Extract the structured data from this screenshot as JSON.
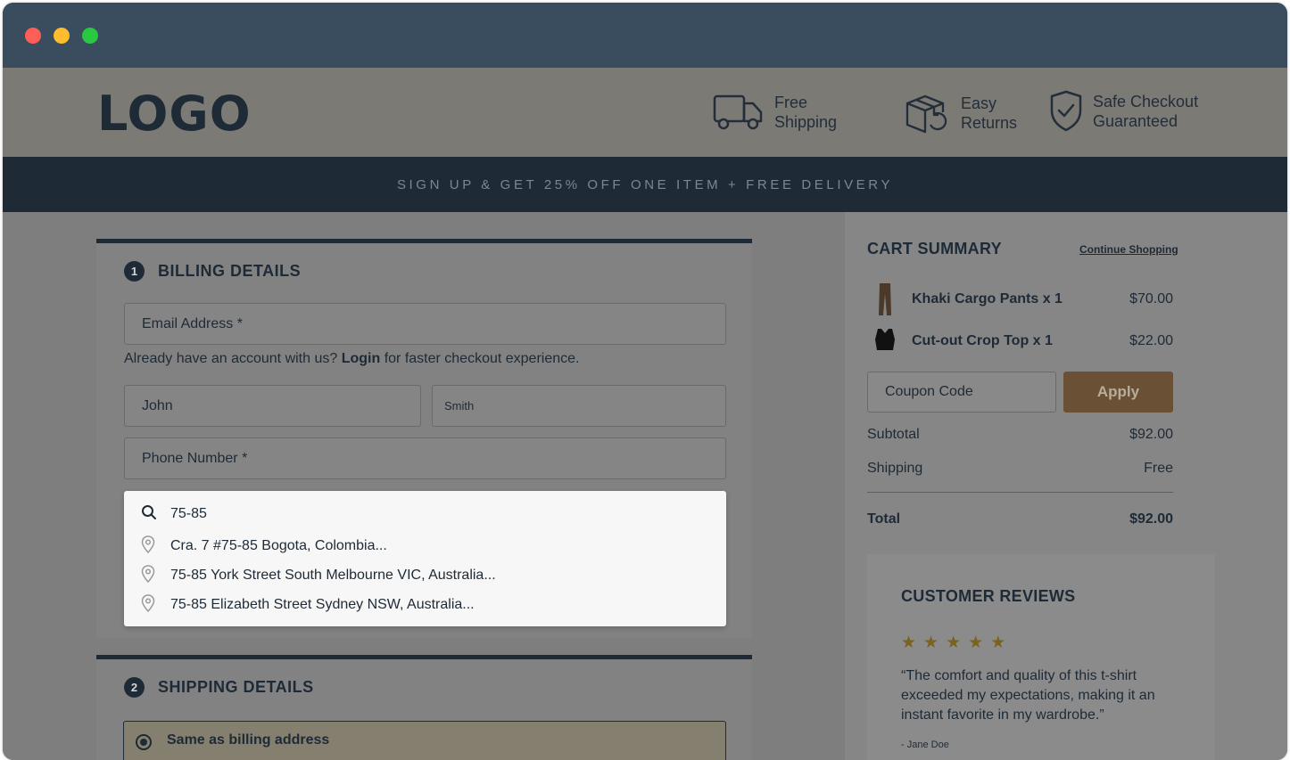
{
  "window": {
    "controls": [
      "close",
      "minimize",
      "maximize"
    ]
  },
  "header": {
    "logo": "LOGO",
    "features": [
      {
        "icon": "truck-icon",
        "line1": "Free",
        "line2": "Shipping"
      },
      {
        "icon": "returns-box-icon",
        "line1": "Easy",
        "line2": "Returns"
      },
      {
        "icon": "shield-check-icon",
        "line1": "Safe Checkout",
        "line2": "Guaranteed"
      }
    ]
  },
  "promo": {
    "text": "SIGN UP & GET 25% OFF ONE ITEM + FREE DELIVERY"
  },
  "billing": {
    "number": "1",
    "title": "BILLING DETAILS",
    "email_placeholder": "Email Address *",
    "account_hint_prefix": "Already have an account with us? ",
    "account_hint_link": "Login",
    "account_hint_suffix": " for faster checkout experience.",
    "first_name": "John",
    "last_name": "Smith",
    "phone_placeholder": "Phone Number *",
    "address_search": {
      "query": "75-85",
      "suggestions": [
        "Cra. 7 #75-85 Bogota, Colombia...",
        "75-85 York Street South Melbourne VIC, Australia...",
        "75-85 Elizabeth Street Sydney NSW, Australia..."
      ]
    }
  },
  "shipping": {
    "number": "2",
    "title": "SHIPPING DETAILS",
    "option_label": "Same as billing address"
  },
  "cart": {
    "title": "CART SUMMARY",
    "continue_link": "Continue Shopping",
    "items": [
      {
        "name": "Khaki Cargo Pants x 1",
        "price": "$70.00"
      },
      {
        "name": "Cut-out Crop Top x 1",
        "price": "$22.00"
      }
    ],
    "coupon_placeholder": "Coupon Code",
    "apply_label": "Apply",
    "subtotal_label": "Subtotal",
    "subtotal_value": "$92.00",
    "shipping_label": "Shipping",
    "shipping_value": "Free",
    "total_label": "Total",
    "total_value": "$92.00"
  },
  "reviews": {
    "title": "CUSTOMER REVIEWS",
    "rating": 5,
    "quote": "“The comfort and quality of this t-shirt exceeded my expectations, making it an instant favorite in my wardrobe.”",
    "author": "- Jane Doe"
  },
  "colors": {
    "header_dark": "#1e2a36",
    "apply_button": "#6a5035",
    "star": "#7a6220",
    "titlebar": "#3a4d5e"
  }
}
